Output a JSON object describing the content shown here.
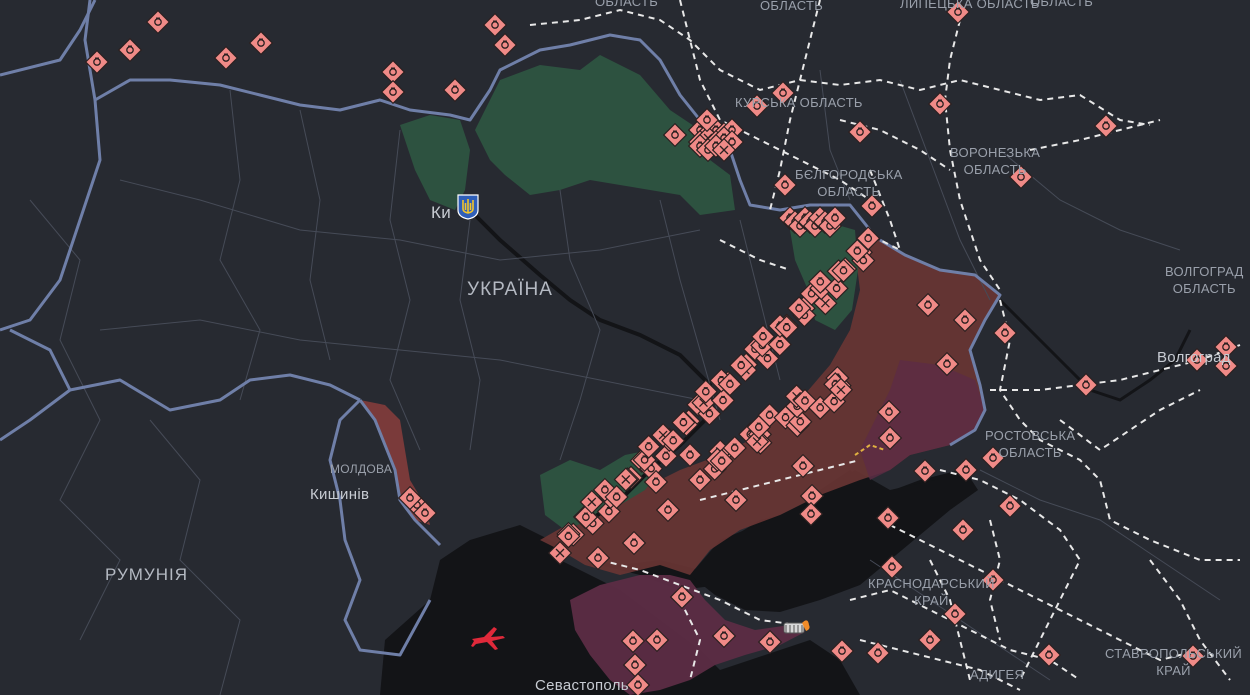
{
  "labels": {
    "ukraine": "УКРАЇНА",
    "kyiv": "Ки",
    "moldova": "МОЛДОВА",
    "chisinau": "Кишинів",
    "romania": "РУМУНІЯ",
    "sevastopol": "Севастополь",
    "kursk": "КУРСЬКА ОБЛАСТЬ",
    "belgorod_1": "БЄЛГОРОДСЬКА",
    "belgorod_2": "ОБЛАСТЬ",
    "voronezh_1": "ВОРОНЕЗЬКА",
    "voronezh_2": "ОБЛАСТЬ",
    "lipetsk": "ЛИПЕЦЬКА ОБЛАСТЬ",
    "top_oblast_1": "ОБЛАСТЬ",
    "top_oblast_2": "ОБЛАСТЬ",
    "top_oblast_3": "ОБЛАСТЬ",
    "volgograd_1": "ВОЛГОГРАД",
    "volgograd_2": "ОБЛАСТЬ",
    "volgograd_city": "Волгоград",
    "rostov_1": "РОСТОВСЬКА",
    "rostov_2": "ОБЛАСТЬ",
    "krasnodar_1": "КРАСНОДАРСЬКИЙ",
    "krasnodar_2": "КРАЙ",
    "stavropol_1": "СТАВРОПОЛЬСЬКИЙ",
    "stavropol_2": "КРАЙ",
    "adygea": "АДИГЕЯ"
  },
  "colors": {
    "land": "#272a31",
    "sea": "#131417",
    "country_border": "#6f7fa8",
    "occupied": "#6a3534",
    "crimea": "#5c2c45",
    "liberated": "#2d5240",
    "transnistria": "#7a3a3a",
    "marker": "#f08a87",
    "marker_stroke": "#2b2020",
    "route": "#e8e8e8"
  },
  "icons": {
    "marker": "explosion-marker-icon",
    "coat_of_arms": "trident-coat-of-arms-icon",
    "aircraft": "red-aircraft-icon",
    "bridge": "crimean-bridge-icon"
  }
}
